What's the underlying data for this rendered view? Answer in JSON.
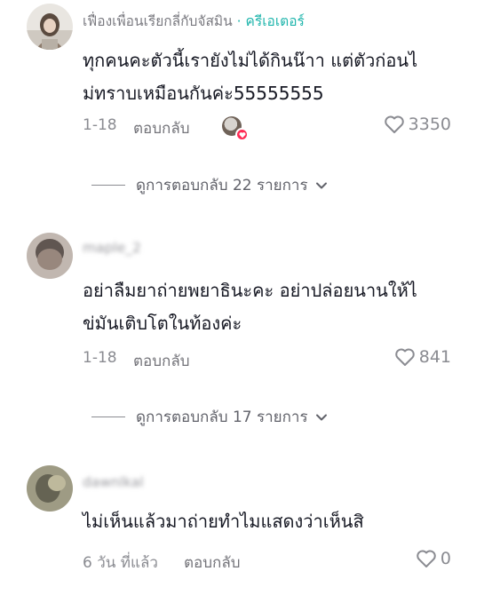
{
  "comments": [
    {
      "username": "เฟื่องเพื่อนเรียกลี่กับจัสมิน",
      "separator": " · ",
      "creator_tag": "ครีเอเตอร์",
      "text": "ทุกคนคะตัวนี้เรายังไม่ได้กินน๊าา แต่ตัวก่อนไ\nม่ทราบเหมือนกันค่ะ55555555",
      "date": "1-18",
      "reply_label": "ตอบกลับ",
      "likes": "3350",
      "view_replies": "ดูการตอบกลับ 22 รายการ"
    },
    {
      "username": "maple_2",
      "text": "อย่าลืมยาถ่ายพยาธินะคะ อย่าปล่อยนานให้ไ\nข่มันเติบโตในท้องค่ะ",
      "date": "1-18",
      "reply_label": "ตอบกลับ",
      "likes": "841",
      "view_replies": "ดูการตอบกลับ 17 รายการ"
    },
    {
      "username": "dawnlkal",
      "text": "ไม่เห็นแล้วมาถ่ายทำไมแสดงว่าเห็นสิ",
      "date": "6 วัน ที่แล้ว",
      "reply_label": "ตอบกลับ",
      "likes": "0"
    }
  ],
  "colors": {
    "creator_tag": "#1fb5ac",
    "liked_heart": "#fe2c55",
    "muted": "#8a8b91"
  },
  "icons": [
    "heart-outline-icon",
    "chevron-down-icon",
    "creator-liked-heart-icon"
  ]
}
